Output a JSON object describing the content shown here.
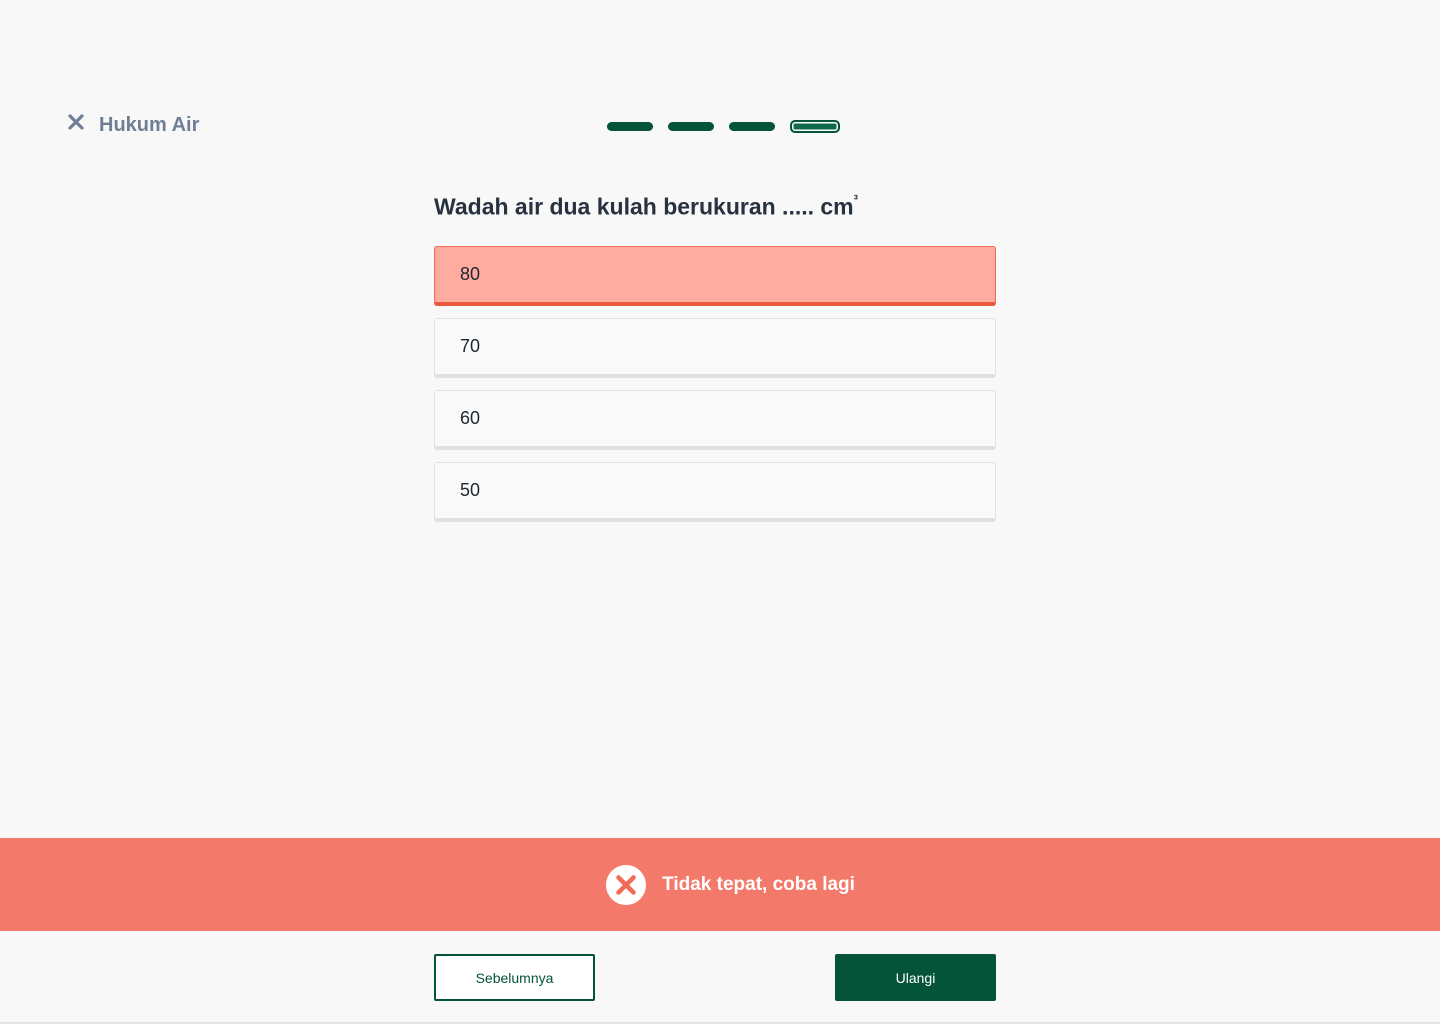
{
  "header": {
    "close_icon": "close-icon",
    "title": "Hukum Air"
  },
  "progress": {
    "total_steps": 4,
    "current_step": 4,
    "color": "#04543a"
  },
  "question": {
    "text": "Wadah air dua kulah berukuran ..... cm",
    "superscript": "³"
  },
  "options": [
    {
      "label": "80",
      "state": "wrong"
    },
    {
      "label": "70",
      "state": "default"
    },
    {
      "label": "60",
      "state": "default"
    },
    {
      "label": "50",
      "state": "default"
    }
  ],
  "feedback": {
    "icon": "x-circle-icon",
    "text": "Tidak tepat, coba lagi",
    "color": "#f37a6a"
  },
  "footer": {
    "prev_label": "Sebelumnya",
    "retry_label": "Ulangi",
    "accent": "#04543a"
  }
}
